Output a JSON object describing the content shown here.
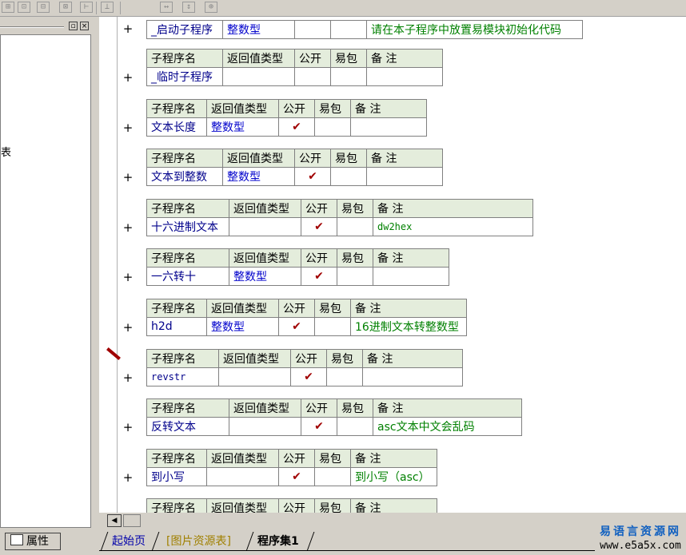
{
  "toolbar": {
    "icons": [
      "align-left-icon",
      "align-top-icon",
      "align-center-icon",
      "align-right-icon",
      "distribute-h-icon",
      "distribute-v-icon",
      "same-width-icon",
      "same-height-icon",
      "same-size-icon"
    ]
  },
  "left_panel": {
    "fragment_text": "表",
    "properties_tab": "属性"
  },
  "subroutines": [
    {
      "headers": null,
      "name": "_启动子程序",
      "ret": "整数型",
      "public": false,
      "easy_pack": false,
      "note": "请在本子程序中放置易模块初始化代码",
      "note_mono": false
    },
    {
      "headers": [
        "子程序名",
        "返回值类型",
        "公开",
        "易包",
        "备 注"
      ],
      "name": "_临时子程序",
      "ret": "",
      "public": false,
      "easy_pack": false,
      "note": "",
      "note_mono": false
    },
    {
      "headers": [
        "子程序名",
        "返回值类型",
        "公开",
        "易包",
        "备 注"
      ],
      "name": "文本长度",
      "ret": "整数型",
      "public": true,
      "easy_pack": false,
      "note": "",
      "note_mono": false
    },
    {
      "headers": [
        "子程序名",
        "返回值类型",
        "公开",
        "易包",
        "备 注"
      ],
      "name": "文本到整数",
      "ret": "整数型",
      "public": true,
      "easy_pack": false,
      "note": "",
      "note_mono": false
    },
    {
      "headers": [
        "子程序名",
        "返回值类型",
        "公开",
        "易包",
        "备 注"
      ],
      "name": "十六进制文本",
      "ret": "",
      "public": true,
      "easy_pack": false,
      "note": "dw2hex",
      "note_mono": true
    },
    {
      "headers": [
        "子程序名",
        "返回值类型",
        "公开",
        "易包",
        "备 注"
      ],
      "name": "一六转十",
      "ret": "整数型",
      "public": true,
      "easy_pack": false,
      "note": "",
      "note_mono": false
    },
    {
      "headers": [
        "子程序名",
        "返回值类型",
        "公开",
        "易包",
        "备 注"
      ],
      "name": "h2d",
      "ret": "整数型",
      "public": true,
      "easy_pack": false,
      "note": "16进制文本转整数型",
      "note_mono": false
    },
    {
      "headers": [
        "子程序名",
        "返回值类型",
        "公开",
        "易包",
        "备 注"
      ],
      "name": "revstr",
      "ret": "",
      "public": true,
      "easy_pack": false,
      "note": "",
      "note_mono": false
    },
    {
      "headers": [
        "子程序名",
        "返回值类型",
        "公开",
        "易包",
        "备 注"
      ],
      "name": "反转文本",
      "ret": "",
      "public": true,
      "easy_pack": false,
      "note": "asc文本中文会乱码",
      "note_mono": false
    },
    {
      "headers": [
        "子程序名",
        "返回值类型",
        "公开",
        "易包",
        "备 注"
      ],
      "name": "到小写",
      "ret": "",
      "public": true,
      "easy_pack": false,
      "note": "到小写（asc）",
      "note_mono": false
    },
    {
      "headers": [
        "子程序名",
        "返回值类型",
        "公开",
        "易包",
        "备 注"
      ],
      "name": null,
      "ret": null,
      "public": false,
      "easy_pack": false,
      "note": null,
      "note_mono": false
    }
  ],
  "check_mark": "✔",
  "plus_mark": "+",
  "tabs": [
    "起始页",
    "[图片资源表]",
    "程序集1"
  ],
  "active_tab": "程序集1",
  "watermark": {
    "line1": "易语言资源网",
    "line2": "www.e5a5x.com"
  }
}
